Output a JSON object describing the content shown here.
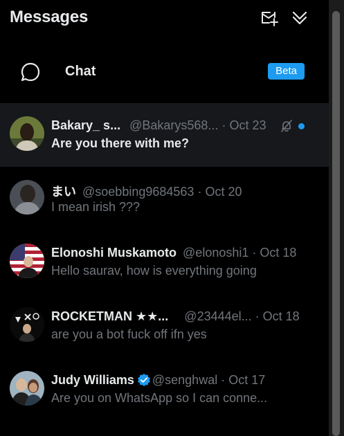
{
  "header": {
    "title": "Messages",
    "compose_icon": "new-message-icon",
    "collapse_icon": "double-chevron-down-icon"
  },
  "chat_row": {
    "label": "Chat",
    "badge": "Beta",
    "icon": "speech-bubble-icon"
  },
  "conversations": [
    {
      "name": "Bakary_ s...",
      "handle": "@Bakarys568...",
      "sep": " · ",
      "date": "Oct 23",
      "preview": "Are you there with me?",
      "unread": true,
      "muted": true
    },
    {
      "name": "まい",
      "handle": "@soebbing9684563",
      "sep": " · ",
      "date": "Oct 20",
      "preview": "I mean irish ???",
      "unread": false
    },
    {
      "name": "Elonoshi Muskamoto",
      "handle": "@elonoshi1",
      "sep": " · ",
      "date": "Oct 18",
      "preview": "Hello saurav, how is everything going",
      "unread": false
    },
    {
      "name": "ROCKETMAN ★★...",
      "handle": "@23444el...",
      "sep": " · ",
      "date": "Oct 18",
      "preview": "are you a bot fuck off ifn yes",
      "unread": false
    },
    {
      "name": "Judy Williams",
      "handle": "@senghwal",
      "sep": " · ",
      "date": "Oct 17",
      "preview": "Are you on WhatsApp so I can conne...",
      "unread": false,
      "verified": true
    }
  ],
  "colors": {
    "accent": "#1d9bf0",
    "background": "#000000",
    "active_row": "#16181c",
    "secondary_text": "#71767b",
    "primary_text": "#e7e9ea"
  }
}
